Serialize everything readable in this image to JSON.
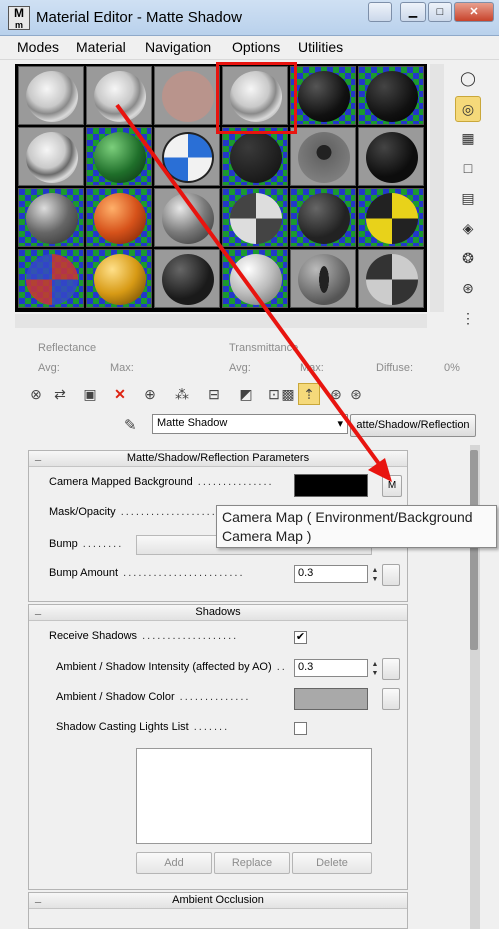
{
  "window": {
    "title": "Material Editor - Matte Shadow",
    "app_icon_label": "M"
  },
  "menu": [
    "Modes",
    "Material",
    "Navigation",
    "Options",
    "Utilities"
  ],
  "slots": {
    "rows": [
      [
        "landscape-sphere",
        "landscape-sphere",
        "pink-sphere",
        "landscape-sphere",
        "black-sphere",
        "black-sphere"
      ],
      [
        "landscape-sphere",
        "green-sphere",
        "bmw-sphere",
        "patterned-sphere",
        "exclamation-sphere",
        "black-sphere"
      ],
      [
        "chrome-sphere",
        "orange-sphere",
        "gray-sphere",
        "checker-sphere",
        "patterned-sphere",
        "yellow-checker-sphere"
      ],
      [
        "checker-sphere",
        "gold-sphere",
        "patterned-sphere",
        "white-sphere",
        "eye-sphere",
        "checker-sphere"
      ]
    ],
    "selected_slot": "row-1-col-4"
  },
  "reflectance": {
    "title": "Reflectance",
    "avg_label": "Avg:",
    "max_label": "Max:"
  },
  "transmittance": {
    "title": "Transmittance",
    "avg_label": "Avg:",
    "max_label": "Max:",
    "diffuse_label": "Diffuse:",
    "diffuse_value": "0%"
  },
  "toolbar_icons": [
    "get-material-icon",
    "put-to-scene-icon",
    "assign-icon",
    "delete-icon",
    "make-unique-icon",
    "material-id-icon",
    "put-to-library-icon",
    "show-map-icon",
    "show-end-icon",
    "background-icon",
    "go-to-parent-icon",
    "go-forward-icon",
    "pick-icon"
  ],
  "material": {
    "name": "Matte Shadow",
    "type_button": "atte/Shadow/Reflection"
  },
  "matte_rollout": {
    "title": "Matte/Shadow/Reflection Parameters",
    "camera_bg_label": "Camera Mapped Background",
    "camera_bg_button": "M",
    "mask_label": "Mask/Opacity",
    "bump_label": "Bump",
    "bump_map_button": "None",
    "bump_amount_label": "Bump Amount",
    "bump_amount_value": "0.3"
  },
  "tooltip": {
    "line1": "Camera Map  ( Environment/Background",
    "line2": "Camera Map )"
  },
  "shadows_rollout": {
    "title": "Shadows",
    "receive_label": "Receive Shadows",
    "receive_checked": "✔",
    "ambient_intensity_label": "Ambient / Shadow Intensity (affected by AO)",
    "ambient_intensity_value": "0.3",
    "ambient_color_label": "Ambient / Shadow Color",
    "casting_lights_label": "Shadow Casting Lights List",
    "add_button": "Add",
    "replace_button": "Replace",
    "delete_button": "Delete"
  },
  "ao_rollout": {
    "title": "Ambient Occlusion"
  },
  "colors": {
    "annotation_arrow": "#e8140f",
    "selection_box": "#e8140f",
    "shadow_color_swatch": "#a9a9a9",
    "camera_bg_swatch": "#000000"
  }
}
